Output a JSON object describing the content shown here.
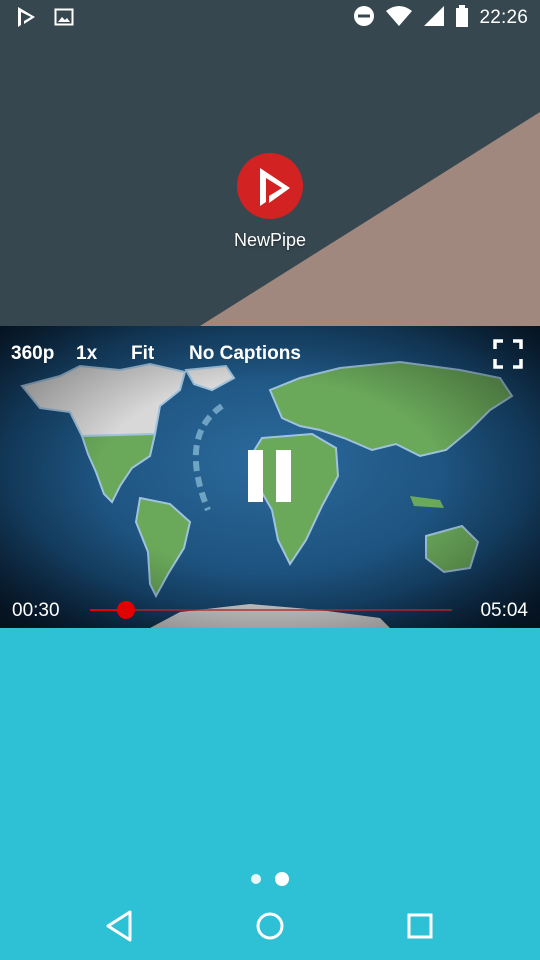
{
  "status_bar": {
    "time": "22:26",
    "left_icons": [
      "newpipe-notification-icon",
      "image-notification-icon"
    ],
    "right_icons": [
      "do-not-disturb-icon",
      "wifi-icon",
      "signal-icon",
      "battery-icon"
    ]
  },
  "home": {
    "app_label": "NewPipe",
    "wallpaper_colors": {
      "dark": "#37474f",
      "light": "#a1887f"
    },
    "brand_color": "#d32222"
  },
  "player": {
    "quality": "360p",
    "speed": "1x",
    "resize": "Fit",
    "captions": "No Captions",
    "current_time": "00:30",
    "total_time": "05:04",
    "progress_fraction": 0.1,
    "accent_color": "#e50000",
    "state": "playing",
    "controls_icons": [
      "fullscreen-icon",
      "pause-icon"
    ]
  },
  "launcher": {
    "background_color": "#2ec0d4",
    "pages": 2,
    "active_page": 1
  },
  "nav_bar": {
    "icons": [
      "back-icon",
      "home-icon",
      "recents-icon"
    ]
  }
}
